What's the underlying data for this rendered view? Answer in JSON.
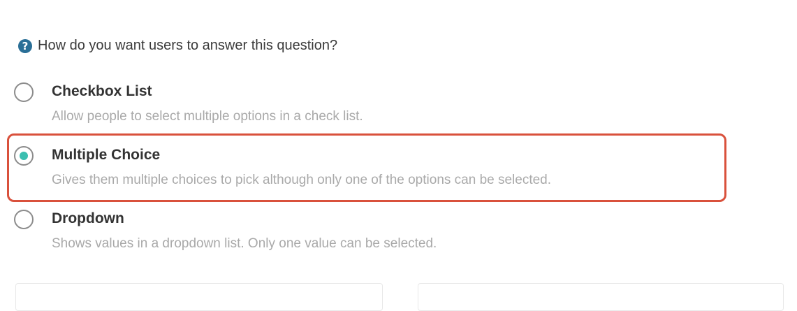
{
  "question": {
    "icon": "question-circle-icon",
    "text": "How do you want users to answer this question?"
  },
  "options": [
    {
      "label": "Checkbox List",
      "description": "Allow people to select multiple options in a check list.",
      "selected": false
    },
    {
      "label": "Multiple Choice",
      "description": "Gives them multiple choices to pick although only one of the options can be selected.",
      "selected": true
    },
    {
      "label": "Dropdown",
      "description": "Shows values in a dropdown list. Only one value can be selected.",
      "selected": false
    }
  ],
  "colors": {
    "selected_dot": "#3bbfb0",
    "highlight_border": "#d9513c",
    "help_icon": "#2a6f97"
  }
}
